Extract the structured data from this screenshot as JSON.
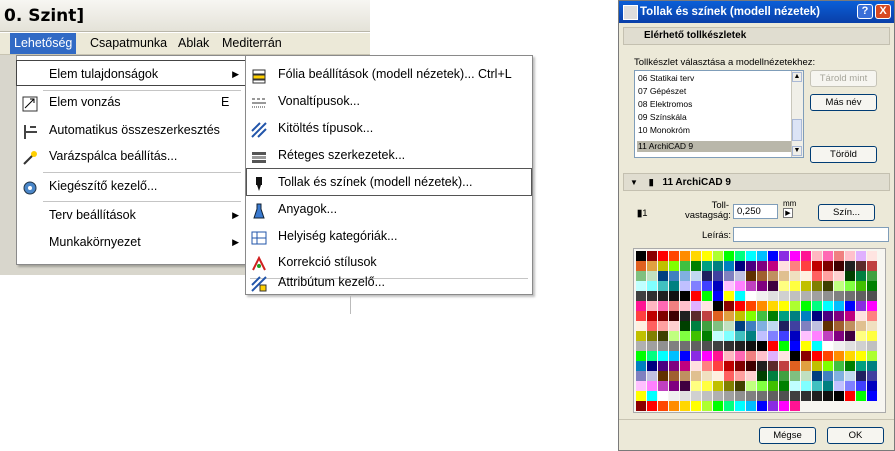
{
  "window": {
    "title": "0. Szint]"
  },
  "menubar": {
    "items": [
      "Lehetőség",
      "Csapatmunka",
      "Ablak",
      "Mediterrán"
    ],
    "active": "Lehetőség"
  },
  "left_menu": {
    "items": [
      {
        "label": "Elem tulajdonságok",
        "has_submenu": true
      },
      {
        "label": "Elem vonzás",
        "shortcut": "E"
      },
      {
        "label": "Automatikus összeszerkesztés"
      },
      {
        "label": "Varázspálca beállítás..."
      },
      {
        "label": "Kiegészítő kezelő..."
      },
      {
        "label": "Terv beállítások",
        "has_submenu": true
      },
      {
        "label": "Munkakörnyezet",
        "has_submenu": true
      }
    ]
  },
  "submenu": {
    "items": [
      {
        "label": "Fólia beállítások (modell nézetek)...",
        "shortcut": "Ctrl+L"
      },
      {
        "label": "Vonaltípusok..."
      },
      {
        "label": "Kitöltés típusok..."
      },
      {
        "label": "Réteges szerkezetek..."
      },
      {
        "label": "Tollak és színek (modell nézetek)..."
      },
      {
        "label": "Anyagok..."
      },
      {
        "label": "Helyiség kategóriák..."
      },
      {
        "label": "Korrekció stílusok"
      },
      {
        "label": "Attribútum kezelő..."
      }
    ]
  },
  "dialog": {
    "title": "Tollak és színek (modell nézetek)",
    "help_btn": "?",
    "close_btn": "X",
    "section1": "Elérhető tollkészletek",
    "list_caption": "Tollkészlet választása a modellnézetekhez:",
    "list_items": [
      "06 Statikai terv",
      "07 Gépészet",
      "08 Elektromos",
      "09 Színskála",
      "10 Monokróm",
      "11 ArchiCAD 9"
    ],
    "selected": "11 ArchiCAD 9",
    "btn_store": "Tárold mint",
    "btn_rename": "Más név",
    "btn_delete": "Töröld",
    "section2": "11 ArchiCAD 9",
    "pen_number": "1",
    "thickness_label_1": "Toll-",
    "thickness_label_2": "vastagság:",
    "thickness_value": "0,250",
    "unit": "mm",
    "color_btn": "Szín...",
    "desc_label": "Leírás:",
    "cancel_btn": "Mégse",
    "ok_btn": "OK"
  },
  "colors": {
    "accent": "#316ac5",
    "title_bar": "#0a3fa8",
    "palette": [
      [
        "#000000",
        "#8b0000",
        "#ff0000",
        "#ff4500",
        "#ff8c00",
        "#ffd700",
        "#ffff00",
        "#adff2f",
        "#00ff00",
        "#00ff7f",
        "#00ffff",
        "#00bfff",
        "#0000ff",
        "#8a2be2",
        "#ff00ff",
        "#ff1493",
        "#ffb6c1",
        "#ff69b4",
        "#f08080",
        "#ffc0cb",
        "#e0b0ff",
        "#ffe4e1"
      ],
      [
        "#202020",
        "#5c2b2b",
        "#c04040",
        "#e06020",
        "#e0a040",
        "#c0c000",
        "#80ff00",
        "#40c040",
        "#008000",
        "#00a080",
        "#008080",
        "#0080c0",
        "#000080",
        "#4b0082",
        "#800080",
        "#c00080",
        "#ffe0e0",
        "#ff8080",
        "#ff4040",
        "#c00000",
        "#800000",
        "#400000"
      ],
      [
        "#ff6060",
        "#ffa0a0",
        "#ffd0d0",
        "#004000",
        "#008040",
        "#40a040",
        "#80c080",
        "#c0e0c0",
        "#004080",
        "#4080c0",
        "#80b0e0",
        "#c0d8f0",
        "#202060",
        "#4040a0",
        "#8080c0",
        "#c0c0e0",
        "#603000",
        "#a06030",
        "#c09060",
        "#e0c090",
        "#f0e0c0",
        "#fff0e0"
      ],
      [
        "#ffff80",
        "#ffff40",
        "#c0c000",
        "#808000",
        "#404000",
        "#c0ff80",
        "#80ff40",
        "#40c000",
        "#008000",
        "#c0ffff",
        "#80ffff",
        "#40c0c0",
        "#008080",
        "#c0c0ff",
        "#8080ff",
        "#4040ff",
        "#0000c0",
        "#ffc0ff",
        "#ff80ff",
        "#c040c0",
        "#800080",
        "#400040"
      ],
      [
        "#ffffff",
        "#f0f0f0",
        "#e0e0e0",
        "#d0d0d0",
        "#c0c0c0",
        "#b0b0b0",
        "#a0a0a0",
        "#909090",
        "#808080",
        "#707070",
        "#606060",
        "#505050",
        "#404040",
        "#303030",
        "#202020",
        "#101010",
        "#000000",
        "#ff0000",
        "#00ff00",
        "#0000ff",
        "#ffff00",
        "#00ffff"
      ]
    ]
  }
}
